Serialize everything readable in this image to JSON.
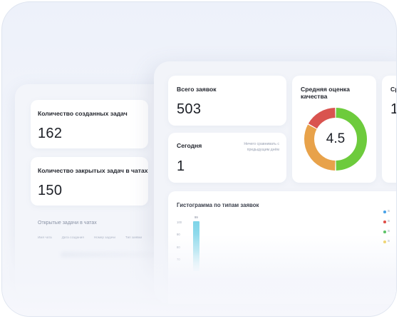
{
  "left_panel": {
    "created_tasks": {
      "label": "Количество созданных задач",
      "value": "162"
    },
    "closed_tasks": {
      "label": "Количество закрытых задач в чатах",
      "value": "150"
    },
    "open_tasks": {
      "title": "Открытые задачи в чатах",
      "columns": [
        "Имя чата",
        "Дата создания",
        "Номер задачи",
        "Тип заявки"
      ]
    }
  },
  "front_panel": {
    "total": {
      "label": "Всего заявок",
      "value": "503"
    },
    "today": {
      "label": "Сегодня",
      "value": "1",
      "note": "Нечего сравнивать с предыдущим днём"
    },
    "quality": {
      "label": "Средняя оценка качества",
      "value": "4.5",
      "segments": [
        {
          "status": "good",
          "fraction": 0.5,
          "color": "#6dcb3c"
        },
        {
          "status": "neutral",
          "fraction": 0.33,
          "color": "#e8a24a"
        },
        {
          "status": "bad",
          "fraction": 0.17,
          "color": "#d9534f"
        }
      ]
    },
    "extra_card": {
      "label": "Ср",
      "value": "1,"
    },
    "histogram": {
      "label": "Гистограмма по типам заявок",
      "y_ticks": [
        "100",
        "90",
        "80",
        "70"
      ],
      "bar_value": "99",
      "legend": [
        {
          "text": "S",
          "color": "#4aa3e8"
        },
        {
          "text": "S",
          "color": "#e0504a"
        },
        {
          "text": "S",
          "color": "#5fc46a"
        },
        {
          "text": "S",
          "color": "#f0d060"
        }
      ]
    }
  }
}
